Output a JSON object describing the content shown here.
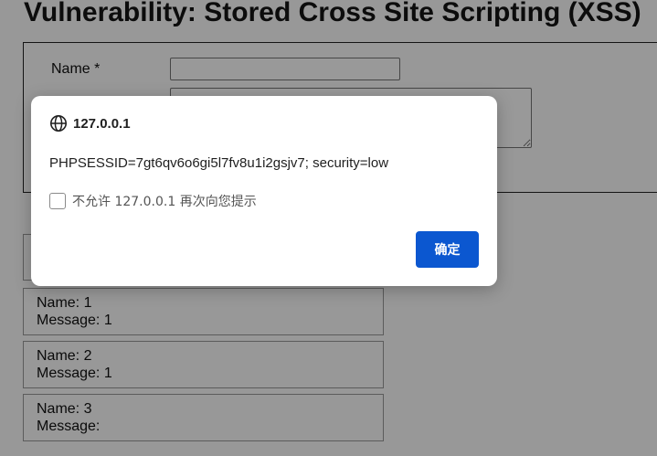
{
  "page": {
    "title": "Vulnerability: Stored Cross Site Scripting (XSS)",
    "name_label": "Name *",
    "name_value": "",
    "message_value": ""
  },
  "guestbook": {
    "entries": [
      {
        "name": "Name: 1",
        "message": "Message: 1"
      },
      {
        "name": "Name: 2",
        "message": "Message: 1"
      },
      {
        "name": "Name: 3",
        "message": "Message:"
      }
    ]
  },
  "dialog": {
    "origin": "127.0.0.1",
    "message": "PHPSESSID=7gt6qv6o6gi5l7fv8u1i2gsjv7; security=low",
    "suppress_label": "不允许 127.0.0.1 再次向您提示",
    "suppress_checked": false,
    "ok_label": "确定",
    "icon": "globe-icon",
    "accent_color": "#0b57d0"
  }
}
